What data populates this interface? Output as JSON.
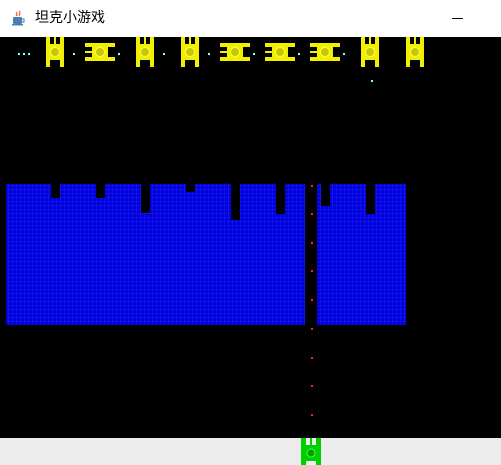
{
  "window": {
    "title": "坦克小游戏",
    "icon": "java-cup-icon"
  },
  "colors": {
    "background": "#000000",
    "enemy_tank": "#f0f000",
    "enemy_tank_core": "#c8c800",
    "player_tank": "#00d000",
    "water": "#0000d8",
    "water_grid": "#1e1eff",
    "enemy_bullet": "#88ffff",
    "player_bullet": "#ff2020"
  },
  "game": {
    "enemy_tanks": [
      {
        "facing": "vertical"
      },
      {
        "facing": "horizontal"
      },
      {
        "facing": "vertical"
      },
      {
        "facing": "vertical"
      },
      {
        "facing": "horizontal"
      },
      {
        "facing": "horizontal"
      },
      {
        "facing": "horizontal"
      },
      {
        "facing": "vertical"
      },
      {
        "facing": "vertical"
      }
    ],
    "player_tank": {
      "facing": "up"
    },
    "water_blocks": 2
  }
}
